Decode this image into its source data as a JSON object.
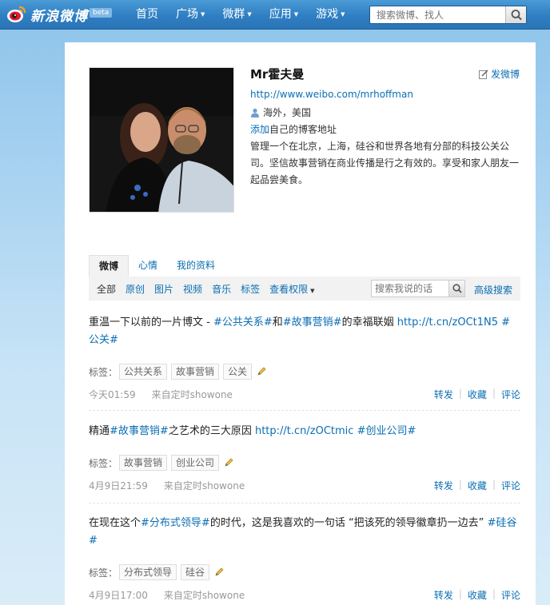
{
  "brand": {
    "logo_text": "新浪微博",
    "beta": "beta"
  },
  "nav": [
    {
      "label": "首页",
      "dropdown": false
    },
    {
      "label": "广场",
      "dropdown": true
    },
    {
      "label": "微群",
      "dropdown": true
    },
    {
      "label": "应用",
      "dropdown": true
    },
    {
      "label": "游戏",
      "dropdown": true
    }
  ],
  "search": {
    "placeholder": "搜索微博、找人"
  },
  "profile": {
    "name": "Mr霍夫曼",
    "post_button": "发微博",
    "url": "http://www.weibo.com/mrhoffman",
    "location": "海外，美国",
    "add_blog_link": "添加",
    "add_blog_rest": "自己的博客地址",
    "bio": "管理一个在北京，上海，硅谷和世界各地有分部的科技公关公司。坚信故事营销在商业传播是行之有效的。享受和家人朋友一起品尝美食。"
  },
  "tabs": [
    "微博",
    "心情",
    "我的资料"
  ],
  "filters": [
    "全部",
    "原创",
    "图片",
    "视频",
    "音乐",
    "标签",
    "查看权限"
  ],
  "my_search": {
    "placeholder": "搜索我说的话",
    "advanced": "高级搜索"
  },
  "labels": {
    "tags": "标签：",
    "repost": "转发",
    "favorite": "收藏",
    "comment": "评论"
  },
  "posts": [
    {
      "text_a": "重温一下以前的一片博文 - ",
      "tag1": "#公共关系#",
      "text_b": "和",
      "tag2": "#故事营销#",
      "text_c": "的幸福联姻 ",
      "link": "http://t.cn/zOCt1N5",
      "tag3": " #公关#",
      "tags": [
        "公共关系",
        "故事营销",
        "公关"
      ],
      "time": "今天01:59",
      "source": "来自定时showone"
    },
    {
      "text_a": "精通",
      "tag1": "#故事营销#",
      "text_b": "之艺术的三大原因 ",
      "link": "http://t.cn/zOCtmic",
      "tag2": " #创业公司#",
      "tags": [
        "故事营销",
        "创业公司"
      ],
      "time": "4月9日21:59",
      "source": "来自定时showone"
    },
    {
      "text_a": "在现在这个",
      "tag1": "#分布式领导#",
      "text_b": "的时代，这是我喜欢的一句话 “把该死的领导徽章扔一边去” ",
      "tag2": "#硅谷#",
      "tags": [
        "分布式领导",
        "硅谷"
      ],
      "time": "4月9日17:00",
      "source": "来自定时showone"
    }
  ],
  "colors": {
    "link": "#0a6eb4",
    "topbar": "#2f7fc3",
    "background": "#a9d3f1"
  }
}
